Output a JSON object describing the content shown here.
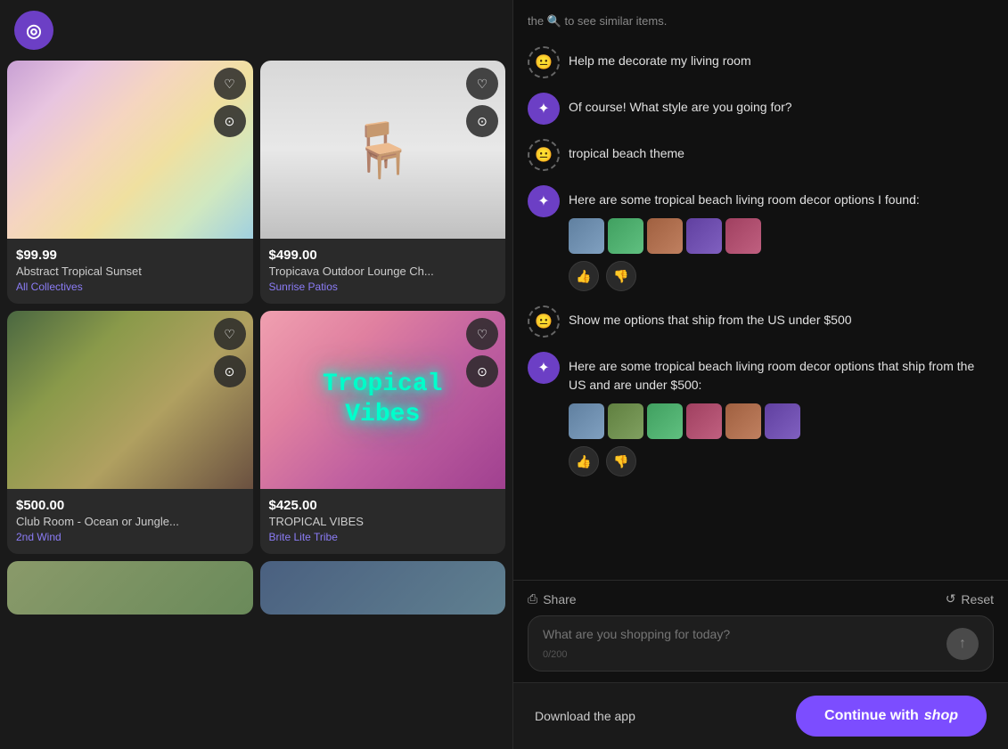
{
  "app": {
    "avatar_emoji": "◎"
  },
  "left_panel": {
    "products": [
      {
        "id": "p1",
        "price": "$99.99",
        "name": "Abstract Tropical Sunset",
        "brand": "All Collectives",
        "img_class": "img-abstract-sunset"
      },
      {
        "id": "p2",
        "price": "$499.00",
        "name": "Tropicava Outdoor Lounge Ch...",
        "brand": "Sunrise Patios",
        "img_class": "img-lounge-chair"
      },
      {
        "id": "p3",
        "price": "$500.00",
        "name": "Club Room - Ocean or Jungle...",
        "brand": "2nd Wind",
        "img_class": "img-ocean-room"
      },
      {
        "id": "p4",
        "price": "$425.00",
        "name": "TROPICAL VIBES",
        "brand": "Brite Lite Tribe",
        "img_class": "img-tropical-vibes"
      }
    ]
  },
  "chat": {
    "fade_text": "the 🔍 to see similar items.",
    "messages": [
      {
        "id": "m1",
        "type": "user",
        "text": "Help me decorate my living room"
      },
      {
        "id": "m2",
        "type": "ai",
        "text": "Of course! What style are you going for?"
      },
      {
        "id": "m3",
        "type": "user",
        "text": "tropical beach theme"
      },
      {
        "id": "m4",
        "type": "ai",
        "text": "Here are some tropical beach living room decor options I found:",
        "has_thumbnails": true,
        "has_reactions": true
      },
      {
        "id": "m5",
        "type": "user",
        "text": "Show me options that ship from the US under $500"
      },
      {
        "id": "m6",
        "type": "ai",
        "text": "Here are some tropical beach living room decor options that ship from the US and are under $500:",
        "has_thumbnails": true,
        "has_reactions": true
      }
    ],
    "input_placeholder": "What are you shopping for today?",
    "char_count": "0/200"
  },
  "footer": {
    "share_label": "Share",
    "reset_label": "Reset",
    "download_label": "Download the app",
    "continue_label": "Continue with",
    "shop_label": "shop"
  }
}
